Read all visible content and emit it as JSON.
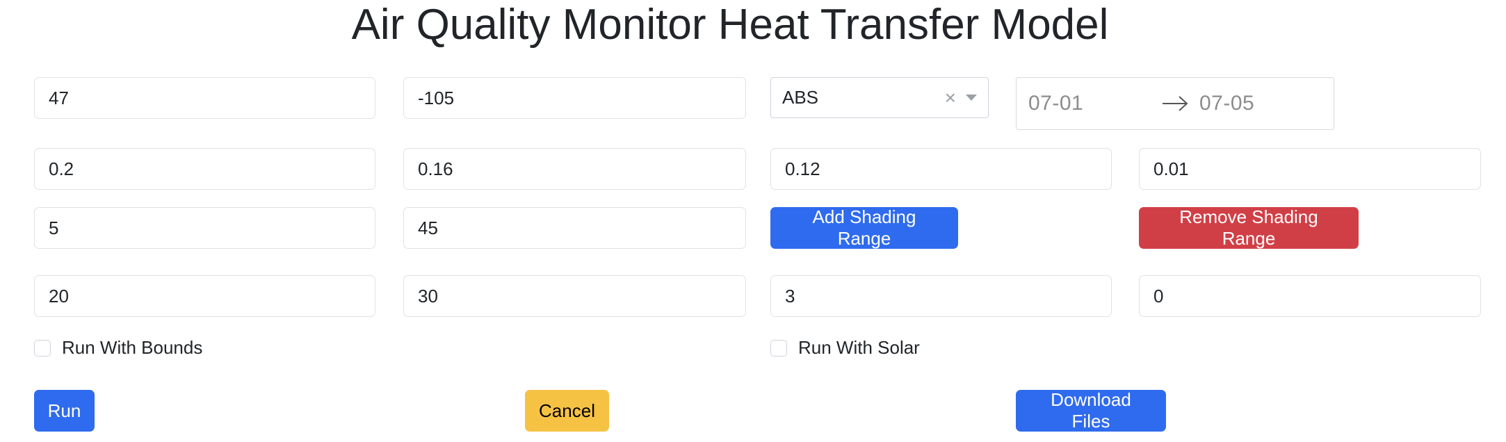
{
  "title": "Air Quality Monitor Heat Transfer Model",
  "inputs": {
    "latitude": "47",
    "longitude": "-105",
    "p1": "0.2",
    "p2": "0.16",
    "p3": "0.12",
    "p4": "0.01",
    "shade_a": "5",
    "shade_b": "45",
    "b1": "20",
    "b2": "30",
    "b3": "3",
    "b4": "0"
  },
  "material": {
    "value": "ABS",
    "clear_icon": "×"
  },
  "date_range": {
    "start": "07-01",
    "end": "07-05"
  },
  "buttons": {
    "add_shading": "Add Shading Range",
    "remove_shading": "Remove Shading Range",
    "run": "Run",
    "cancel": "Cancel",
    "download": "Download Files"
  },
  "checkboxes": {
    "bounds": "Run With Bounds",
    "solar": "Run With Solar"
  },
  "colors": {
    "primary": "#2f6bee",
    "danger": "#d13f46",
    "warning": "#f6c244"
  }
}
